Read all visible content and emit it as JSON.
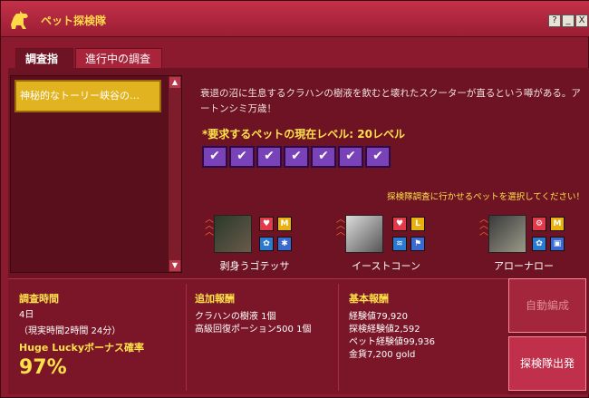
{
  "window": {
    "title": "ペット探検隊",
    "buttons": [
      "?",
      "_",
      "X"
    ]
  },
  "tabs": [
    {
      "label": "調査指示"
    },
    {
      "label": "進行中の調査"
    }
  ],
  "mission_list": {
    "items": [
      "神秘的なトーリー峡谷の…"
    ]
  },
  "mission": {
    "description": "衰退の沼に生息するクラハンの樹液を飲むと壊れたスクーターが直るという噂がある。アートンシミ万歳！",
    "required_level": "*要求するペットの現在レベル: 20レベル",
    "check_count": 7,
    "select_message": "探検隊調査に行かせるペットを選択してください！"
  },
  "pets": [
    {
      "name": "剥身うゴテッサ",
      "icons": [
        "heart-icon",
        "M"
      ]
    },
    {
      "name": "イーストコーン",
      "icons": [
        "heart-icon",
        "L"
      ]
    },
    {
      "name": "アローナロー",
      "icons": [
        "gear-icon",
        "M"
      ]
    }
  ],
  "time": {
    "label": "調査時間",
    "days": "4日",
    "real_time": "（現実時間2時間 24分）"
  },
  "bonus": {
    "label": "Huge Luckyボーナス確率",
    "value": "97%"
  },
  "extra_reward": {
    "label": "追加報酬",
    "items": [
      "クラハンの樹液 1個",
      "高級回復ポーション500 1個"
    ]
  },
  "base_reward": {
    "label": "基本報酬",
    "items": [
      "経験値79,920",
      "探検経験値2,592",
      "ペット経験値99,936",
      "金貨7,200 gold"
    ]
  },
  "buttons": {
    "auto": "自動編成",
    "dispatch": "探検隊出発"
  }
}
